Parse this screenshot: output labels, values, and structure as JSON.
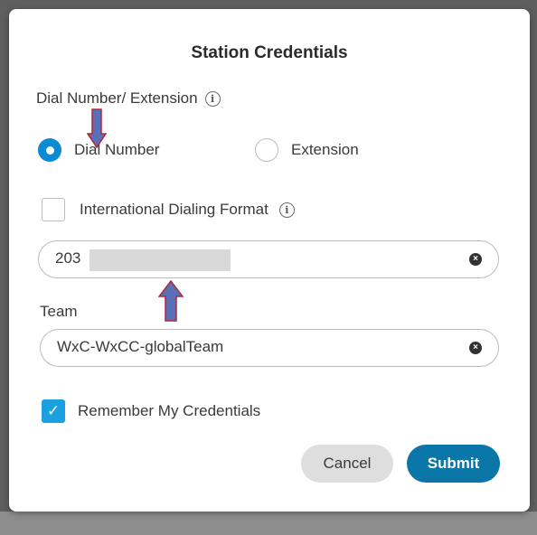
{
  "dialog": {
    "title": "Station Credentials",
    "section_label": "Dial Number/ Extension",
    "info_glyph": "i",
    "radio_dial_label": "Dial Number",
    "radio_extension_label": "Extension",
    "intl_format_label": "International Dialing Format",
    "dial_value": "203",
    "team_label": "Team",
    "team_value": "WxC-WxCC-globalTeam",
    "clear_glyph": "×",
    "remember_label": "Remember My Credentials",
    "check_glyph": "✓",
    "cancel_label": "Cancel",
    "submit_label": "Submit"
  },
  "state": {
    "selected_radio": "dial-number",
    "intl_format_checked": false,
    "remember_checked": true
  },
  "colors": {
    "accent_radio": "#0d8ad4",
    "checkbox_checked": "#1a9fe0",
    "submit_button": "#0a77a8",
    "annotation_arrow_fill": "#5a6fb8",
    "annotation_arrow_outline": "#b0283a"
  }
}
